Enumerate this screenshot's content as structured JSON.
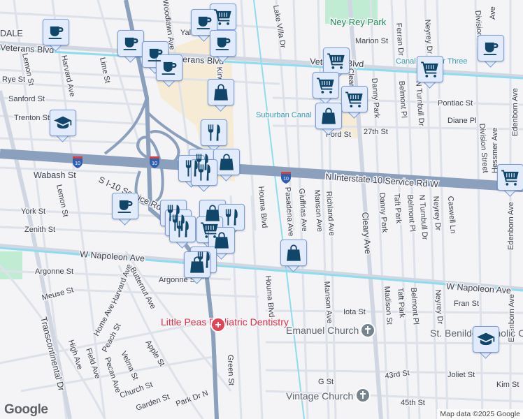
{
  "map": {
    "attribution": "Map data ©2025 Google",
    "logo": "Google",
    "colors": {
      "background": "#f4f3f5",
      "highway": "#8aa0bc",
      "road": "#dde2ea",
      "canal": "#8fdcef",
      "commercial": "#f6ecd6",
      "park": "#bfecd2",
      "marker_fill": "#e2ebfb",
      "marker_icon": "#0f4669"
    }
  },
  "roads": {
    "veterans_left": "Veterans Blvd",
    "veterans_mid": "Veterans Blvd",
    "veterans_right": "Veterans Blvd",
    "i10_service": "N Interstate 10 Service Rd W",
    "s_i10_service": "S I-10 Service Rd W",
    "napoleon_left": "W Napoleon Ave",
    "napoleon_right": "W Napoleon Ave",
    "shield": "10"
  },
  "streets": {
    "dale": "DALE",
    "lemon1": "Lemon St",
    "harvard1": "Harvard Ave",
    "lime": "Lime St",
    "rye": "Rye St",
    "sanford": "Sanford St",
    "trenton": "Trenton St",
    "woodlawn": "Woodlawn Ave",
    "yale": "Yale St",
    "king": "Kingman St",
    "wabash": "Wabash St",
    "lemon2": "Lemon St",
    "york": "York St",
    "zenith": "Zenith St",
    "houma1": "Houma Blvd",
    "houma2": "Houma Blvd",
    "lake_villa": "Lake Villa Dr",
    "marion": "Marion St",
    "ferran": "Ferran Dr",
    "neyrey1": "Neyrey Dr",
    "division1": "Division St",
    "edenborn_top": "Ave",
    "cleary1": "Cleary Ave",
    "danny1": "Danny Park",
    "belmont1": "Belmont Pl",
    "turnbull1": "N Turnbull Dr",
    "pontiac": "Pontiac St",
    "diane": "Diane Pl",
    "ford": "Ford St",
    "st27": "27th St",
    "division2": "Division Street",
    "hessmer": "Hessmer Ave",
    "edenborn1": "Edenborn Ave",
    "pasadena": "Pasadena Ave",
    "giuffrias": "Giuffrias Ave",
    "manson1": "Manson Ave",
    "richland": "Richland Ave",
    "cleary2": "Cleary Ave",
    "danny2": "Danny Park",
    "taft1": "Taft Park",
    "belmont2": "Belmont Pl",
    "turnbull2": "N Turnbull Dr",
    "neyrey2": "Neyrey Dr",
    "caswell": "Caswell Ln",
    "edenborn2": "Edenborn Ave",
    "argonne1": "Argonne St",
    "meuse": "Meuse St",
    "harvard2": "Harvard Ave",
    "butternut": "Butternut Ave",
    "home": "Home Ave",
    "peach": "Peach St",
    "high": "High Ave",
    "field": "Field Ave",
    "pecan": "Pecan Ave",
    "velma": "Velma St",
    "apple": "Apple St",
    "church": "Church St",
    "garden": "Garden St",
    "park_dr": "Park Dr N",
    "transcontinental": "Transcontinental Dr",
    "green": "Green St",
    "manson2": "Manson Ave",
    "iota": "Iota St",
    "madison": "Madison St",
    "taft2": "Taft Park",
    "belmont3": "Belmont Pl",
    "neyrey3": "Neyrey Dr",
    "fran": "Fran St",
    "edenborn3": "Edenborn Ave",
    "st43": "43rd St",
    "joliet": "Joliet St",
    "kim": "Kim St",
    "g": "G St",
    "st45": "45th St"
  },
  "places": {
    "park": "Ney Rey Park",
    "canal_suburban": "Suburban Canal",
    "canal_three": "Canal Number Three",
    "dentistry": "Little Peas Pediatric Dentistry",
    "emanuel": "Emanuel Church",
    "vintage": "Vintage Church",
    "benilde": "St. Benilde Catholic Church"
  }
}
